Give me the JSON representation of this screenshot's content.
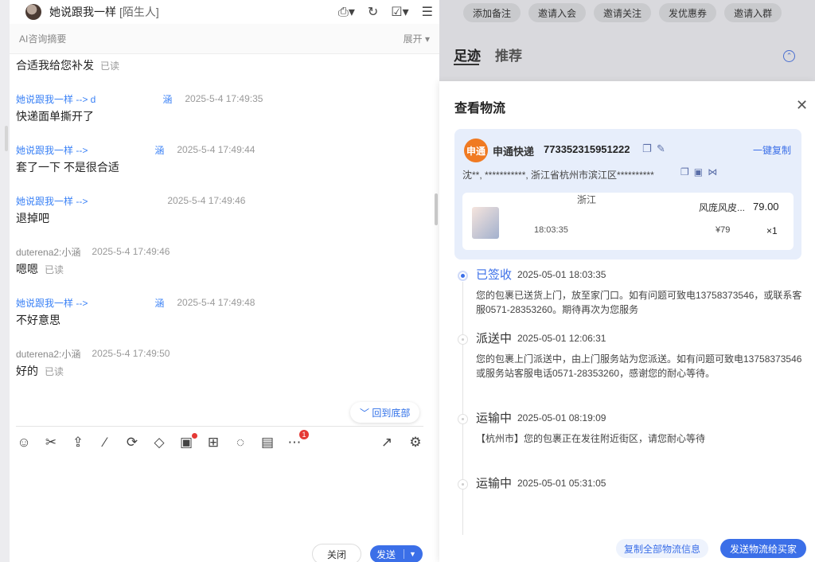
{
  "chat": {
    "contact_name": "她说跟我一样",
    "contact_tag": "[陌生人]",
    "ai_summary_label": "AI咨询摘要",
    "expand_label": "展开",
    "messages": [
      {
        "type": "text",
        "text": "合适我给您补发",
        "read": "已读"
      },
      {
        "type": "meta",
        "sender": "她说跟我一样 --> d",
        "suffix": "涵",
        "time": "2025-5-4 17:49:35"
      },
      {
        "type": "text",
        "text": "快递面单撕开了"
      },
      {
        "type": "meta",
        "sender": "她说跟我一样 -->",
        "suffix": "涵",
        "time": "2025-5-4 17:49:44"
      },
      {
        "type": "text",
        "text": "套了一下 不是很合适"
      },
      {
        "type": "meta",
        "sender": "她说跟我一样 -->",
        "suffix": "",
        "time": "2025-5-4 17:49:46"
      },
      {
        "type": "text",
        "text": "退掉吧"
      },
      {
        "type": "meta_gray",
        "sender": "duterena2:小涵",
        "time": "2025-5-4 17:49:46"
      },
      {
        "type": "text",
        "text": "嗯嗯",
        "read": "已读"
      },
      {
        "type": "meta",
        "sender": "她说跟我一样 -->",
        "suffix": "涵",
        "time": "2025-5-4 17:49:48"
      },
      {
        "type": "text",
        "text": "不好意思"
      },
      {
        "type": "meta_gray",
        "sender": "duterena2:小涵",
        "time": "2025-5-4 17:49:50"
      },
      {
        "type": "text",
        "text": "好的",
        "read": "已读"
      }
    ],
    "back_to_bottom": "回到底部",
    "close_label": "关闭",
    "send_label": "发送",
    "toolbar_badge": "1"
  },
  "background": {
    "tags": [
      "添加备注",
      "邀请入会",
      "邀请关注",
      "发优惠券",
      "邀请入群"
    ],
    "tabs": [
      "足迹",
      "推荐"
    ]
  },
  "logistics": {
    "title": "查看物流",
    "courier_logo": "申通",
    "courier_name": "申通快递",
    "tracking_no": "773352315951222",
    "copy_one_label": "一键复制",
    "address": "沈**, ***********, 浙江省杭州市滨江区**********",
    "item": {
      "region": "浙江",
      "name": "风庞风皮...",
      "price": "79.00",
      "time": "18:03:35",
      "unit_price": "¥79",
      "qty": "×1"
    },
    "events": [
      {
        "status": "已签收",
        "time": "2025-05-01 18:03:35",
        "desc": "您的包裹已送货上门，放至家门口。如有问题可致电13758373546，或联系客服0571-28353260。期待再次为您服务",
        "active": true
      },
      {
        "status": "派送中",
        "time": "2025-05-01 12:06:31",
        "desc": "您的包裹上门派送中，由上门服务站为您派送。如有问题可致电13758373546或服务站客服电话0571-28353260，感谢您的耐心等待。",
        "active": false
      },
      {
        "status": "运输中",
        "time": "2025-05-01 08:19:09",
        "desc": "【杭州市】您的包裹正在发往附近街区，请您耐心等待",
        "active": false
      },
      {
        "status": "运输中",
        "time": "2025-05-01 05:31:05",
        "desc": "",
        "active": false
      }
    ],
    "copy_all_label": "复制全部物流信息",
    "send_label": "发送物流给买家"
  },
  "colors": {
    "accent": "#3b6fe8",
    "courier": "#f07a22"
  }
}
